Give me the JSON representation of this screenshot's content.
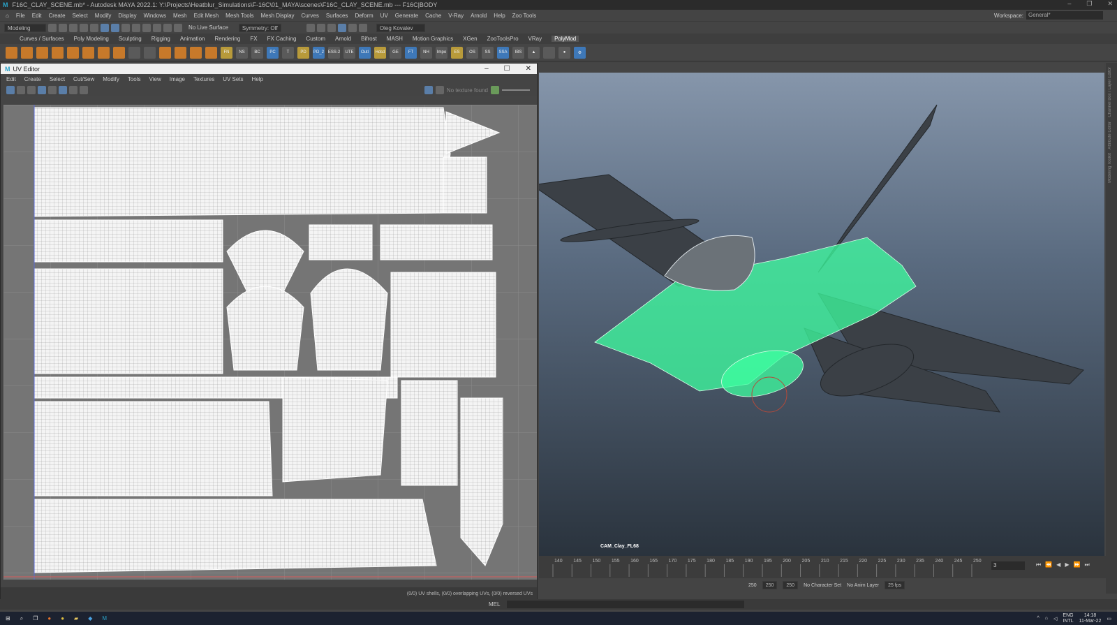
{
  "titlebar": {
    "logo": "M",
    "title": "F16C_CLAY_SCENE.mb* - Autodesk MAYA 2022.1: Y:\\Projects\\Heatblur_Simulations\\F-16C\\01_MAYA\\scenes\\F16C_CLAY_SCENE.mb  ---  F16C|BODY"
  },
  "menubar": {
    "items": [
      "File",
      "Edit",
      "Create",
      "Select",
      "Modify",
      "Display",
      "Windows",
      "Mesh",
      "Edit Mesh",
      "Mesh Tools",
      "Mesh Display",
      "Curves",
      "Surfaces",
      "Deform",
      "UV",
      "Generate",
      "Cache",
      "V-Ray",
      "Arnold",
      "Help",
      "Zoo Tools"
    ],
    "workspace_label": "Workspace:",
    "workspace_value": "General*"
  },
  "statusline": {
    "mode": "Modeling",
    "live_surface": "No Live Surface",
    "symmetry": "Symmetry: Off",
    "user": "Oleg Kovalev"
  },
  "shelf_tabs": [
    "Curves / Surfaces",
    "Poly Modeling",
    "Sculpting",
    "Rigging",
    "Animation",
    "Rendering",
    "FX",
    "FX Caching",
    "Custom",
    "Arnold",
    "Bifrost",
    "MASH",
    "Motion Graphics",
    "XGen",
    "ZooToolsPro",
    "VRay",
    "PolyMod"
  ],
  "shelf_labels": [
    "FN",
    "NS",
    "BC",
    "PC",
    "T",
    "PD",
    "PD_2",
    "ESS-2",
    "UTE",
    "Outl",
    "Hdsd",
    "GE",
    "FT",
    "NH",
    "Impo",
    "ES",
    "OS",
    "SS",
    "SSA",
    "IBS"
  ],
  "uv_editor": {
    "title": "UV Editor",
    "menu": [
      "Edit",
      "Create",
      "Select",
      "Cut/Sew",
      "Modify",
      "Tools",
      "View",
      "Image",
      "Textures",
      "UV Sets",
      "Help"
    ],
    "no_texture": "No texture found",
    "footer": "(0/0) UV shells, (0/0) overlapping UVs, (0/0) reversed UVs"
  },
  "viewport": {
    "camera": "CAM_Clay_FL68"
  },
  "right_strip": [
    "Channel Box / Layer Editor",
    "Attribute Editor",
    "Modeling Toolkit"
  ],
  "timeline": {
    "ticks": [
      "140",
      "145",
      "150",
      "155",
      "160",
      "165",
      "170",
      "175",
      "180",
      "185",
      "190",
      "195",
      "200",
      "205",
      "210",
      "215",
      "220",
      "225",
      "230",
      "235",
      "240",
      "245",
      "250"
    ],
    "current_frame": "3"
  },
  "range": {
    "end_a": "250",
    "end_b": "250",
    "end_c": "250",
    "character_set": "No Character Set",
    "anim_layer": "No Anim Layer",
    "fps": "25 fps"
  },
  "cmdline": {
    "label": "MEL"
  },
  "taskbar": {
    "lang": "ENG",
    "lang2": "INTL",
    "time": "14:18",
    "date": "11-Mar-22"
  },
  "colors": {
    "highlight": "#3dffa0",
    "bg": "#444444"
  }
}
